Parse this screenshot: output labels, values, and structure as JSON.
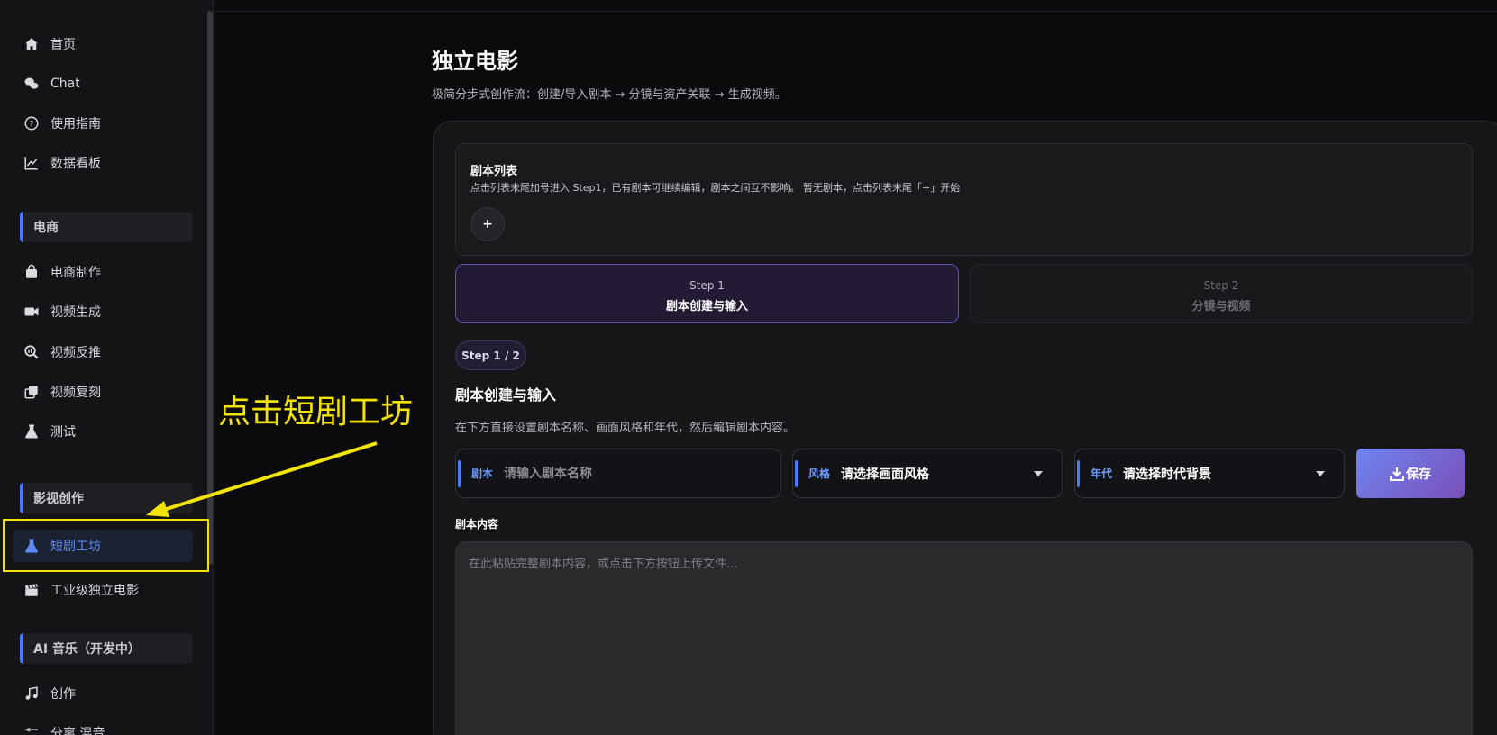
{
  "sidebar": {
    "items": [
      {
        "label": "首页",
        "icon": "home-icon"
      },
      {
        "label": "Chat",
        "icon": "chat-icon"
      },
      {
        "label": "使用指南",
        "icon": "help-icon"
      },
      {
        "label": "数据看板",
        "icon": "chart-icon"
      }
    ],
    "sections": [
      {
        "title": "电商",
        "items": [
          {
            "label": "电商制作",
            "icon": "bag-icon"
          },
          {
            "label": "视频生成",
            "icon": "video-icon"
          },
          {
            "label": "视频反推",
            "icon": "search-icon"
          },
          {
            "label": "视频复刻",
            "icon": "copy-icon"
          },
          {
            "label": "测试",
            "icon": "flask-icon"
          }
        ]
      },
      {
        "title": "影视创作",
        "items": [
          {
            "label": "短剧工坊",
            "icon": "flask-icon",
            "active": true
          },
          {
            "label": "工业级独立电影",
            "icon": "clapper-icon"
          }
        ]
      },
      {
        "title": "AI 音乐（开发中）",
        "items": [
          {
            "label": "创作",
            "icon": "music-icon"
          },
          {
            "label": "分离 混音",
            "icon": "sliders-icon"
          }
        ]
      }
    ]
  },
  "annotation": {
    "text": "点击短剧工坊",
    "color": "#f2e300"
  },
  "page": {
    "title": "独立电影",
    "subtitle": "极简分步式创作流：创建/导入剧本 → 分镜与资产关联 → 生成视频。"
  },
  "script_list": {
    "title": "剧本列表",
    "description": "点击列表末尾加号进入 Step1，已有剧本可继续编辑，剧本之间互不影响。 暂无剧本，点击列表末尾「+」开始",
    "add_label": "+"
  },
  "steps": [
    {
      "step": "Step 1",
      "label": "剧本创建与输入",
      "active": true
    },
    {
      "step": "Step 2",
      "label": "分镜与视频",
      "active": false
    }
  ],
  "current": {
    "badge": "Step 1 / 2",
    "title": "剧本创建与输入",
    "description": "在下方直接设置剧本名称、画面风格和年代，然后编辑剧本内容。"
  },
  "form": {
    "name": {
      "label": "剧本",
      "placeholder": "请输入剧本名称",
      "value": ""
    },
    "style": {
      "label": "风格",
      "value": "请选择画面风格"
    },
    "era": {
      "label": "年代",
      "value": "请选择时代背景"
    },
    "save_label": "保存",
    "content_label": "剧本内容",
    "content_placeholder": "在此粘贴完整剧本内容，或点击下方按钮上传文件..."
  },
  "colors": {
    "accent": "#4c7cf5",
    "active_text": "#5d8bff",
    "step_border": "#6b4fbf"
  }
}
